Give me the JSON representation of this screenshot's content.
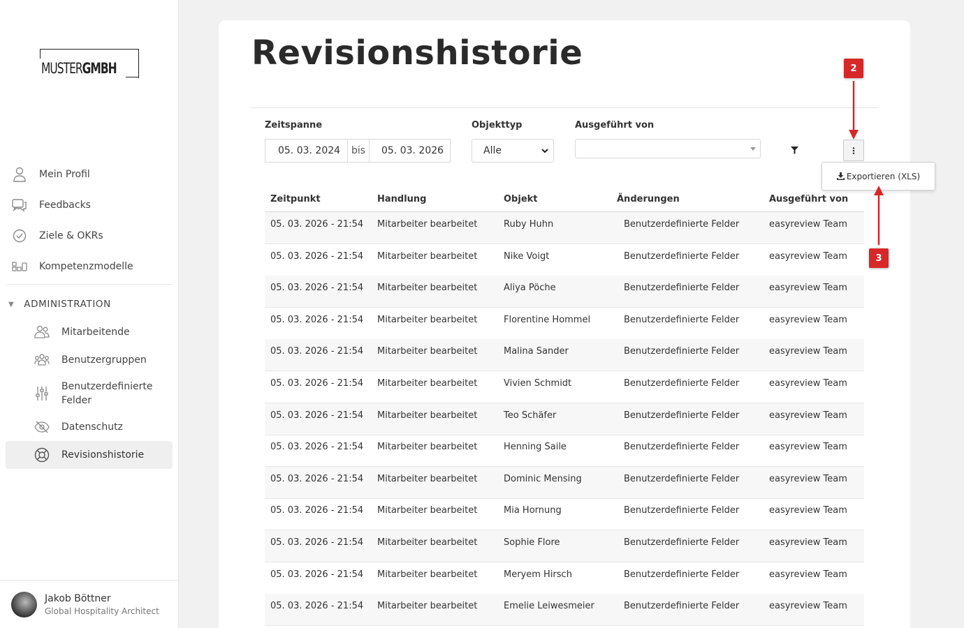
{
  "brand": {
    "logo_light": "MUSTER",
    "logo_bold": "GMBH"
  },
  "sidebar": {
    "items": [
      {
        "label": "Mein Profil",
        "icon": "user-icon"
      },
      {
        "label": "Feedbacks",
        "icon": "chat-icon"
      },
      {
        "label": "Ziele & OKRs",
        "icon": "check-circle-icon"
      },
      {
        "label": "Kompetenzmodelle",
        "icon": "grid-icon"
      }
    ],
    "admin_heading": "ADMINISTRATION",
    "admin_items": [
      {
        "label": "Mitarbeitende",
        "icon": "users-icon"
      },
      {
        "label": "Benutzergruppen",
        "icon": "group-icon"
      },
      {
        "label": "Benutzerdefinierte Felder",
        "icon": "sliders-icon"
      },
      {
        "label": "Datenschutz",
        "icon": "eye-off-icon"
      },
      {
        "label": "Revisionshistorie",
        "icon": "lifebuoy-icon",
        "active": true
      }
    ],
    "user": {
      "name": "Jakob Böttner",
      "role": "Global Hospitality Architect"
    }
  },
  "page": {
    "title": "Revisionshistorie"
  },
  "filters": {
    "zeitspanne_label": "Zeitspanne",
    "date_from": "05. 03. 2024",
    "bis": "bis",
    "date_to": "05. 03. 2026",
    "objekttyp_label": "Objekttyp",
    "objekttyp_value": "Alle",
    "ausgefuehrt_label": "Ausgeführt von",
    "ausgefuehrt_value": ""
  },
  "export_menu": {
    "label": "Exportieren (XLS)"
  },
  "annotations": {
    "badge_2": "2",
    "badge_3": "3",
    "color": "#d62828"
  },
  "table": {
    "headers": [
      "Zeitpunkt",
      "Handlung",
      "Objekt",
      "Änderungen",
      "Ausgeführt von"
    ],
    "rows": [
      [
        "05. 03. 2026 - 21:54",
        "Mitarbeiter bearbeitet",
        "Ruby Huhn",
        "Benutzerdefinierte Felder",
        "easyreview Team"
      ],
      [
        "05. 03. 2026 - 21:54",
        "Mitarbeiter bearbeitet",
        "Nike Voigt",
        "Benutzerdefinierte Felder",
        "easyreview Team"
      ],
      [
        "05. 03. 2026 - 21:54",
        "Mitarbeiter bearbeitet",
        "Aliya Pöche",
        "Benutzerdefinierte Felder",
        "easyreview Team"
      ],
      [
        "05. 03. 2026 - 21:54",
        "Mitarbeiter bearbeitet",
        "Florentine Hommel",
        "Benutzerdefinierte Felder",
        "easyreview Team"
      ],
      [
        "05. 03. 2026 - 21:54",
        "Mitarbeiter bearbeitet",
        "Malina Sander",
        "Benutzerdefinierte Felder",
        "easyreview Team"
      ],
      [
        "05. 03. 2026 - 21:54",
        "Mitarbeiter bearbeitet",
        "Vivien Schmidt",
        "Benutzerdefinierte Felder",
        "easyreview Team"
      ],
      [
        "05. 03. 2026 - 21:54",
        "Mitarbeiter bearbeitet",
        "Teo Schäfer",
        "Benutzerdefinierte Felder",
        "easyreview Team"
      ],
      [
        "05. 03. 2026 - 21:54",
        "Mitarbeiter bearbeitet",
        "Henning Saile",
        "Benutzerdefinierte Felder",
        "easyreview Team"
      ],
      [
        "05. 03. 2026 - 21:54",
        "Mitarbeiter bearbeitet",
        "Dominic Mensing",
        "Benutzerdefinierte Felder",
        "easyreview Team"
      ],
      [
        "05. 03. 2026 - 21:54",
        "Mitarbeiter bearbeitet",
        "Mia Hornung",
        "Benutzerdefinierte Felder",
        "easyreview Team"
      ],
      [
        "05. 03. 2026 - 21:54",
        "Mitarbeiter bearbeitet",
        "Sophie Flore",
        "Benutzerdefinierte Felder",
        "easyreview Team"
      ],
      [
        "05. 03. 2026 - 21:54",
        "Mitarbeiter bearbeitet",
        "Meryem Hirsch",
        "Benutzerdefinierte Felder",
        "easyreview Team"
      ],
      [
        "05. 03. 2026 - 21:54",
        "Mitarbeiter bearbeitet",
        "Emelie Leiwesmeier",
        "Benutzerdefinierte Felder",
        "easyreview Team"
      ]
    ]
  }
}
